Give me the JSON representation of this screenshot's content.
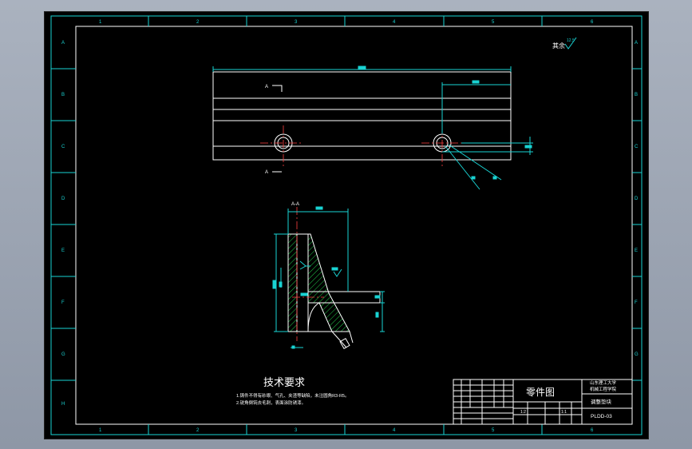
{
  "frame": {
    "columns": [
      "1",
      "2",
      "3",
      "4",
      "5",
      "6"
    ],
    "rows": [
      "A",
      "B",
      "C",
      "D",
      "E",
      "F",
      "G",
      "H"
    ]
  },
  "roughness": {
    "label": "其余",
    "value": "12.5"
  },
  "views": {
    "section_label": "A-A",
    "section_marker": "A"
  },
  "notes": {
    "title": "技术要求",
    "lines": [
      "1.铸件不得有砂眼、气孔、夹渣等缺陷，未注圆角R3-R5。",
      "2.锐角倒钝去毛刺，表面涂防锈漆。"
    ]
  },
  "title_block": {
    "drawing_type": "零件图",
    "school": "山东理工大学",
    "department": "机械工程学院",
    "part_name": "调整垫块",
    "drawing_no": "PLDD-03",
    "scale": "1:1",
    "sheet": "1:2"
  },
  "colors": {
    "frame": "#19d3d3",
    "outline": "#ffffff",
    "hatch": "#22c94a",
    "centerline": "#ff4040",
    "background": "#000000"
  }
}
